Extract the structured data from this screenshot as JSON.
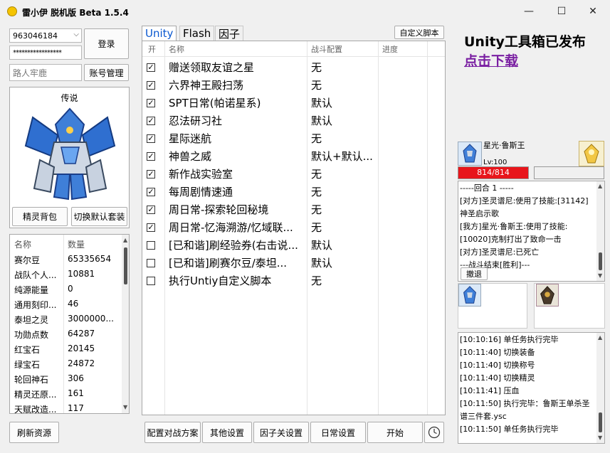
{
  "window": {
    "title": "雷小伊 脱机版 Beta 1.5.4",
    "minimize": "—",
    "maximize": "☐",
    "close": "✕"
  },
  "login": {
    "account": "963046184",
    "password": "*****************",
    "nickname": "路人牢鹿",
    "login_label": "登录",
    "account_manage_label": "账号管理"
  },
  "pet_card": {
    "title": "传说",
    "bag_label": "精灵背包",
    "switch_label": "切换默认套装"
  },
  "inventory": {
    "headers": [
      "名称",
      "数量"
    ],
    "rows": [
      {
        "name": "赛尔豆",
        "value": "65335654"
      },
      {
        "name": "战队个人...",
        "value": "10881"
      },
      {
        "name": "纯源能量",
        "value": "0"
      },
      {
        "name": "通用刻印...",
        "value": "46"
      },
      {
        "name": "泰坦之灵",
        "value": "3000000..."
      },
      {
        "name": "功勋点数",
        "value": "64287"
      },
      {
        "name": "红宝石",
        "value": "20145"
      },
      {
        "name": "绿宝石",
        "value": "24872"
      },
      {
        "name": "轮回神石",
        "value": "306"
      },
      {
        "name": "精灵还原...",
        "value": "161"
      },
      {
        "name": "天赋改造...",
        "value": "117"
      }
    ],
    "refresh_label": "刷新资源"
  },
  "tabs": [
    "Unity",
    "Flash",
    "因子"
  ],
  "custom_script_label": "自定义脚本",
  "tasks": {
    "headers": {
      "enabled": "开",
      "name": "名称",
      "config": "战斗配置",
      "progress": "进度"
    },
    "rows": [
      {
        "checked": true,
        "name": "赠送领取友谊之星",
        "config": "无"
      },
      {
        "checked": true,
        "name": "六界神王殿扫荡",
        "config": "无"
      },
      {
        "checked": true,
        "name": "SPT日常(帕诺星系)",
        "config": "默认"
      },
      {
        "checked": true,
        "name": "忍法研习社",
        "config": "默认"
      },
      {
        "checked": true,
        "name": "星际迷航",
        "config": "无"
      },
      {
        "checked": true,
        "name": "神兽之威",
        "config": "默认+默认..."
      },
      {
        "checked": true,
        "name": "新作战实验室",
        "config": "无"
      },
      {
        "checked": true,
        "name": "每周剧情速通",
        "config": "无"
      },
      {
        "checked": true,
        "name": "周日常-探索轮回秘境",
        "config": "无"
      },
      {
        "checked": true,
        "name": "周日常-忆海溯游/忆域联...",
        "config": "无"
      },
      {
        "checked": false,
        "name": "[已和谐]刷经验券(右击说...",
        "config": "默认"
      },
      {
        "checked": false,
        "name": "[已和谐]刷赛尔豆/泰坦...",
        "config": "默认"
      },
      {
        "checked": false,
        "name": "执行Untiy自定义脚本",
        "config": "无"
      }
    ]
  },
  "bottom_buttons": [
    "配置对战方案",
    "其他设置",
    "因子关设置",
    "日常设置",
    "开始"
  ],
  "clock_icon": "clock-icon",
  "promo": {
    "headline": "Unity工具箱已发布",
    "link": "点击下载",
    "link_color": "#7a1fa2"
  },
  "battle": {
    "pet_name": "星光·鲁斯王",
    "level": "Lv:100",
    "hp": "814/814",
    "hp_fraction": 1.0,
    "enemy_hp_fraction": 0,
    "log": [
      "-----回合 1 -----",
      "[对方]圣灵谱尼:使用了技能:[31142]",
      "神圣启示歌",
      "[我方]星光·鲁斯王:使用了技能:",
      "[10020]克制打出了致命一击",
      "[对方]圣灵谱尼:已死亡",
      "---战斗结束[胜利]---"
    ],
    "retreat_label": "撤退"
  },
  "activity_log": [
    "[10:10:16] 单任务执行完毕",
    "[10:11:40] 切换装备",
    "[10:11:40] 切换称号",
    "[10:11:40] 切换精灵",
    "[10:11:41] 压血",
    "[10:11:50] 执行完毕：鲁斯王单杀圣",
    "谱三件套.ysc",
    "[10:11:50] 单任务执行完毕"
  ],
  "colors": {
    "accent_blue": "#0a58d0",
    "hp_red": "#e8151b"
  }
}
